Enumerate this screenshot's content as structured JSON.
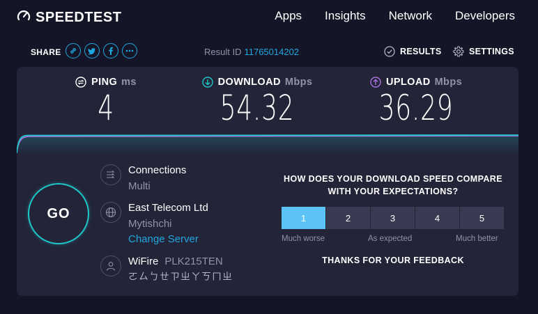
{
  "header": {
    "logo_text": "SPEEDTEST",
    "nav": [
      "Apps",
      "Insights",
      "Network",
      "Developers"
    ]
  },
  "sharebar": {
    "share_label": "SHARE",
    "share_icons": [
      "link-icon",
      "twitter-icon",
      "facebook-icon",
      "more-icon"
    ],
    "result_id_label": "Result ID",
    "result_id": "11765014202",
    "results_label": "RESULTS",
    "settings_label": "SETTINGS"
  },
  "metrics": {
    "ping": {
      "label": "PING",
      "unit": "ms",
      "value": "4"
    },
    "download": {
      "label": "DOWNLOAD",
      "unit": "Mbps",
      "value": "54.32"
    },
    "upload": {
      "label": "UPLOAD",
      "unit": "Mbps",
      "value": "36.29"
    }
  },
  "go_label": "GO",
  "connections": {
    "title": "Connections",
    "value": "Multi"
  },
  "server": {
    "isp": "East Telecom Ltd",
    "location": "Mytishchi",
    "change_link": "Change Server"
  },
  "client": {
    "network": "WiFire",
    "name": "PLK215TEN",
    "subtext": "ㄛㄙㄅㄝㄗㄓㄚㄎㄇㄓ"
  },
  "survey": {
    "question": "HOW DOES YOUR DOWNLOAD SPEED COMPARE WITH YOUR EXPECTATIONS?",
    "options": [
      "1",
      "2",
      "3",
      "4",
      "5"
    ],
    "selected": "1",
    "label_low": "Much worse",
    "label_mid": "As expected",
    "label_high": "Much better",
    "thanks": "THANKS FOR YOUR FEEDBACK"
  },
  "colors": {
    "background": "#141526",
    "card": "#232438",
    "accent_blue": "#1fa7e0",
    "download": "#1fc7c9",
    "upload": "#a972e0",
    "rating_selected": "#5bc3f5"
  }
}
